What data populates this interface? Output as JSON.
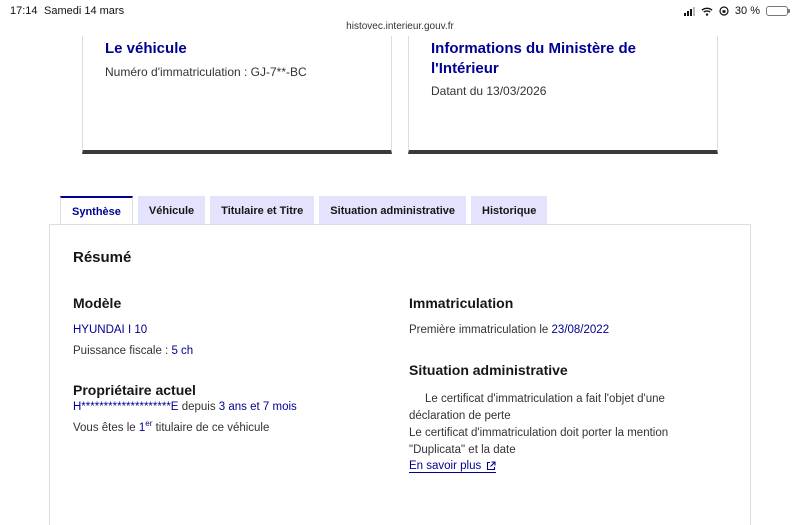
{
  "status_bar": {
    "time": "17:14",
    "date": "Samedi 14 mars",
    "battery": "30 %",
    "battery_level": 0.3
  },
  "browser": {
    "url": "histovec.interieur.gouv.fr"
  },
  "cards": {
    "vehicle": {
      "title": "Le véhicule",
      "registration_label": "Numéro d'immatriculation : GJ-7**-BC"
    },
    "ministry": {
      "title": "Informations du Ministère de l'Intérieur",
      "date_label": "Datant du 13/03/2026"
    }
  },
  "tabs": [
    {
      "label": "Synthèse",
      "active": true
    },
    {
      "label": "Véhicule",
      "active": false
    },
    {
      "label": "Titulaire et Titre",
      "active": false
    },
    {
      "label": "Situation administrative",
      "active": false
    },
    {
      "label": "Historique",
      "active": false
    }
  ],
  "summary": {
    "title": "Résumé",
    "model": {
      "heading": "Modèle",
      "name": "HYUNDAI I 10",
      "power_label": "Puissance fiscale :",
      "power_value": "5 ch"
    },
    "owner": {
      "heading": "Propriétaire actuel",
      "name": "H********************E",
      "since_label": "depuis",
      "since_value": "3 ans et 7 mois",
      "rank_prefix": "Vous êtes le",
      "rank_number": "1",
      "rank_sup": "er",
      "rank_suffix": "titulaire de ce véhicule"
    },
    "registration": {
      "heading": "Immatriculation",
      "first_label": "Première immatriculation le",
      "first_date": "23/08/2022"
    },
    "admin": {
      "heading": "Situation administrative",
      "text1": "Le certificat d'immatriculation a fait l'objet d'une déclaration de perte",
      "text2": "Le certificat d'immatriculation doit porter la mention \"Duplicata\" et la date",
      "link": "En savoir plus"
    }
  }
}
